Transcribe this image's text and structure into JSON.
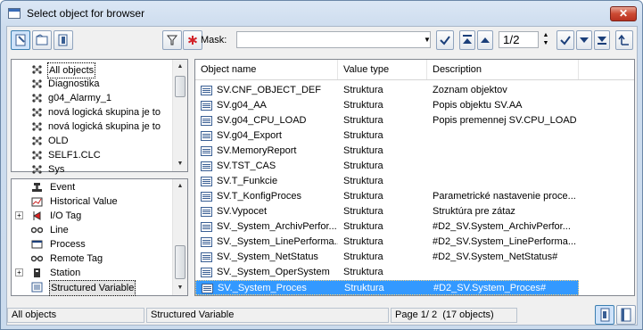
{
  "window": {
    "title": "Select object for browser",
    "close_label": "✕"
  },
  "toolbar": {
    "mask_label": "Mask:",
    "mask_value": "",
    "page_value": "1/2",
    "combo_arrow": "▼",
    "spin_up": "▲",
    "spin_down": "▼"
  },
  "tree_top": {
    "items": [
      {
        "label": "All objects",
        "selected": true
      },
      {
        "label": "Diagnostika"
      },
      {
        "label": "g04_Alarmy_1"
      },
      {
        "label": "nová logická skupina je to"
      },
      {
        "label": "nová logická skupina je to"
      },
      {
        "label": "OLD"
      },
      {
        "label": "SELF1.CLC"
      },
      {
        "label": "Sys"
      }
    ]
  },
  "tree_bottom": {
    "items": [
      {
        "label": "Event",
        "icon": "event-icon"
      },
      {
        "label": "Historical Value",
        "icon": "historical-value-icon"
      },
      {
        "label": "I/O Tag",
        "icon": "io-tag-icon",
        "expander": "+"
      },
      {
        "label": "Line",
        "icon": "line-icon"
      },
      {
        "label": "Process",
        "icon": "process-icon"
      },
      {
        "label": "Remote Tag",
        "icon": "remote-tag-icon"
      },
      {
        "label": "Station",
        "icon": "station-icon",
        "expander": "+"
      },
      {
        "label": "Structured Variable",
        "icon": "structured-variable-icon",
        "selected": true
      }
    ]
  },
  "list": {
    "columns": [
      "Object name",
      "Value type",
      "Description"
    ],
    "rows": [
      {
        "name": "SV.CNF_OBJECT_DEF",
        "type": "Struktura",
        "desc": "Zoznam objektov"
      },
      {
        "name": "SV.g04_AA",
        "type": "Struktura",
        "desc": "Popis objektu SV.AA"
      },
      {
        "name": "SV.g04_CPU_LOAD",
        "type": "Struktura",
        "desc": "Popis premennej SV.CPU_LOAD"
      },
      {
        "name": "SV.g04_Export",
        "type": "Struktura",
        "desc": ""
      },
      {
        "name": "SV.MemoryReport",
        "type": "Struktura",
        "desc": ""
      },
      {
        "name": "SV.TST_CAS",
        "type": "Struktura",
        "desc": ""
      },
      {
        "name": "SV.T_Funkcie",
        "type": "Struktura",
        "desc": ""
      },
      {
        "name": "SV.T_KonfigProces",
        "type": "Struktura",
        "desc": "Parametrické nastavenie proce..."
      },
      {
        "name": "SV.Vypocet",
        "type": "Struktura",
        "desc": "Struktúra pre zátaz"
      },
      {
        "name": "SV._System_ArchivPerfor...",
        "type": "Struktura",
        "desc": "#D2_SV.System_ArchivPerfor..."
      },
      {
        "name": "SV._System_LinePerforma...",
        "type": "Struktura",
        "desc": "#D2_SV.System_LinePerforma..."
      },
      {
        "name": "SV._System_NetStatus",
        "type": "Struktura",
        "desc": "#D2_SV.System_NetStatus#"
      },
      {
        "name": "SV._System_OperSystem",
        "type": "Struktura",
        "desc": ""
      },
      {
        "name": "SV._System_Proces",
        "type": "Struktura",
        "desc": "#D2_SV.System_Proces#",
        "selected": true
      }
    ]
  },
  "status": {
    "left": "All objects",
    "middle": "Structured Variable",
    "page": "Page  1/ 2",
    "count": "(17 objects)"
  },
  "colors": {
    "selection": "#3399ff",
    "title_bg": "#cddcee"
  }
}
